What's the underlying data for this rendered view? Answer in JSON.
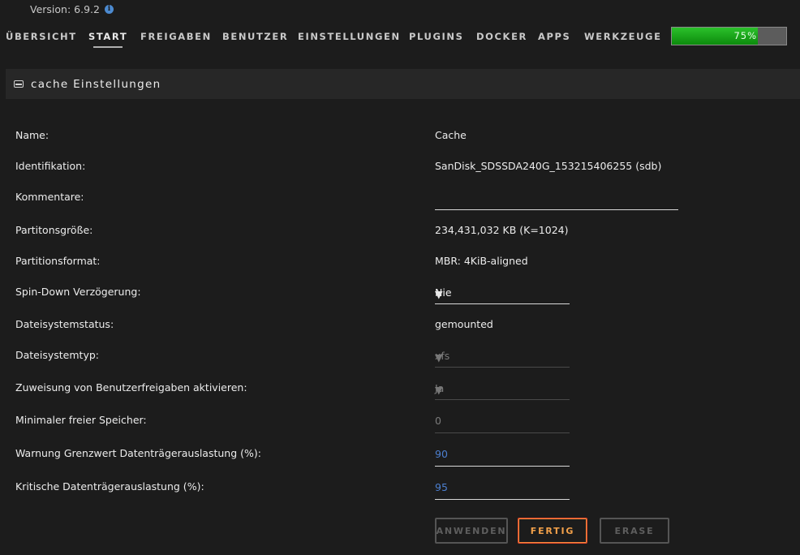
{
  "header": {
    "version": "Version: 6.9.2",
    "nav": [
      {
        "label": "ÜBERSICHT"
      },
      {
        "label": "START"
      },
      {
        "label": "FREIGABEN"
      },
      {
        "label": "BENUTZER"
      },
      {
        "label": "EINSTELLUNGEN"
      },
      {
        "label": "PLUGINS"
      },
      {
        "label": "DOCKER"
      },
      {
        "label": "APPS"
      },
      {
        "label": "WERKZEUGE"
      }
    ],
    "active_nav": "START",
    "usage": {
      "label": "75%",
      "value": 0.75
    }
  },
  "panel": {
    "title": "cache Einstellungen"
  },
  "settings": {
    "name": {
      "label": "Name:",
      "value": "Cache"
    },
    "identification": {
      "label": "Identifikation:",
      "value": "SanDisk_SDSSDA240G_153215406255 (sdb)"
    },
    "comments": {
      "label": "Kommentare:",
      "value": ""
    },
    "partition_size": {
      "label": "Partitonsgröße:",
      "value": "234,431,032 KB (K=1024)"
    },
    "partition_format": {
      "label": "Partitionsformat:",
      "value": "MBR: 4KiB-aligned"
    },
    "spin_down": {
      "label": "Spin-Down Verzögerung:",
      "value": "Nie"
    },
    "fs_status": {
      "label": "Dateisystemstatus:",
      "value": "gemounted"
    },
    "fs_type": {
      "label": "Dateisystemtyp:",
      "value": "xfs"
    },
    "share_assign": {
      "label": "Zuweisung von Benutzerfreigaben aktivieren:",
      "value": "Ja"
    },
    "min_free": {
      "label": "Minimaler freier Speicher:",
      "value": "0"
    },
    "warn_threshold": {
      "label": "Warnung Grenzwert Datenträgerauslastung (%):",
      "value": "90"
    },
    "crit_threshold": {
      "label": "Kritische Datenträgerauslastung (%):",
      "value": "95"
    }
  },
  "buttons": {
    "apply": "ANWENDEN",
    "done": "FERTIG",
    "erase": "ERASE"
  },
  "colors": {
    "accent_blue": "#4c8ad0",
    "done_border": "#e2492d",
    "done_text": "#f3a14a",
    "progress_green": "#1aa51a"
  }
}
